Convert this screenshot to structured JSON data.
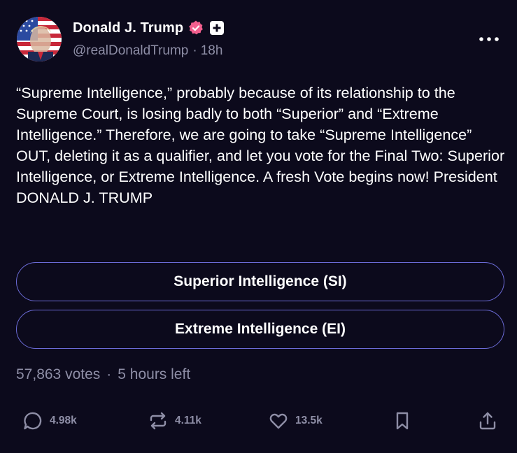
{
  "post": {
    "display_name": "Donald J. Trump",
    "handle": "@realDonaldTrump",
    "separator": "·",
    "time": "18h",
    "text": "“Supreme Intelligence,” probably because of its relationship to the Supreme Court, is losing badly to both “Superior” and “Extreme Intelligence.” Therefore, we are going to take “Supreme Intelligence” OUT, deleting it as a qualifier, and let you vote for the Final Two: Superior Intelligence, or Extreme Intelligence. A fresh Vote begins now! President DONALD J. TRUMP"
  },
  "poll": {
    "options": [
      {
        "label": "Superior Intelligence (SI)"
      },
      {
        "label": "Extreme Intelligence (EI)"
      }
    ],
    "votes": "57,863 votes",
    "separator": "·",
    "time_left": "5 hours left"
  },
  "actions": {
    "replies": "4.98k",
    "retruths": "4.11k",
    "likes": "13.5k"
  },
  "icons": {
    "verified": "verified-badge-icon",
    "plus": "plus-badge-icon",
    "more": "more-dots-icon",
    "reply": "reply-bubble-icon",
    "retruth": "retruth-arrows-icon",
    "like": "heart-icon",
    "bookmark": "bookmark-icon",
    "share": "share-upload-icon"
  },
  "colors": {
    "background": "#0c0a1c",
    "text": "#ffffff",
    "muted": "#8e8ea6",
    "poll_border": "#6b6bd6",
    "verified": "#f25f8e"
  }
}
